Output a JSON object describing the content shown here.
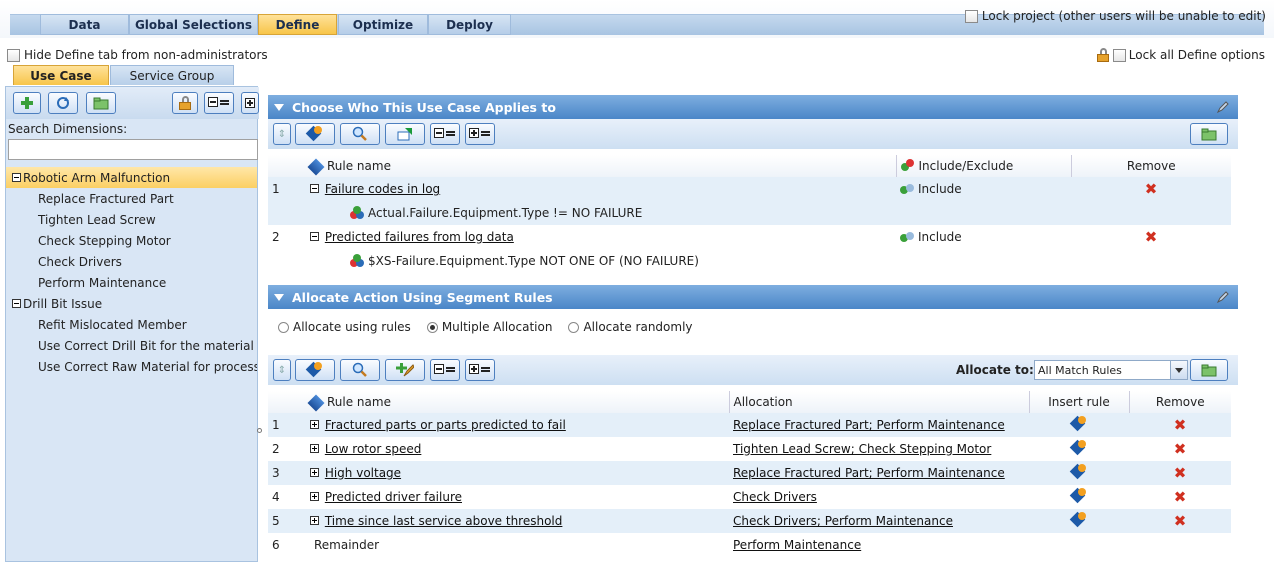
{
  "top_tabs": [
    {
      "label": "Data"
    },
    {
      "label": "Global Selections"
    },
    {
      "label": "Define"
    },
    {
      "label": "Optimize"
    },
    {
      "label": "Deploy"
    }
  ],
  "active_top_tab": "Define",
  "lock_project_label": "Lock project (other users will be unable to edit)",
  "hide_define_label": "Hide Define tab from non-administrators",
  "lock_all_label": "Lock all Define options",
  "sub_tabs": [
    {
      "label": "Use Case"
    },
    {
      "label": "Service Group"
    }
  ],
  "active_sub_tab": "Use Case",
  "left": {
    "search_label": "Search Dimensions:",
    "search_value": "",
    "tree": [
      {
        "label": "Robotic Arm Malfunction",
        "level": 0,
        "selected": true
      },
      {
        "label": "Replace Fractured Part",
        "level": 1
      },
      {
        "label": "Tighten Lead Screw",
        "level": 1
      },
      {
        "label": "Check Stepping Motor",
        "level": 1
      },
      {
        "label": "Check Drivers",
        "level": 1
      },
      {
        "label": "Perform Maintenance",
        "level": 1
      },
      {
        "label": "Drill Bit Issue",
        "level": 0
      },
      {
        "label": "Refit Mislocated Member",
        "level": 1
      },
      {
        "label": "Use Correct Drill Bit for the material",
        "level": 1
      },
      {
        "label": "Use Correct Raw Material for processi",
        "level": 1
      }
    ]
  },
  "who_panel": {
    "title": "Choose Who This Use Case Applies to",
    "headers": {
      "rule": "Rule name",
      "include": "Include/Exclude",
      "remove": "Remove"
    },
    "rows": [
      {
        "num": "1",
        "rule": "Failure codes in log",
        "condition": "Actual.Failure.Equipment.Type != NO FAILURE",
        "include": "Include"
      },
      {
        "num": "2",
        "rule": "Predicted failures from log data",
        "condition": "$XS-Failure.Equipment.Type NOT ONE OF (NO FAILURE)",
        "include": "Include"
      }
    ]
  },
  "alloc_panel": {
    "title": "Allocate Action Using Segment Rules",
    "radio_options": [
      {
        "label": "Allocate using rules",
        "checked": false
      },
      {
        "label": "Multiple Allocation",
        "checked": true
      },
      {
        "label": "Allocate randomly",
        "checked": false
      }
    ],
    "allocate_to_label": "Allocate to:",
    "allocate_to_value": "All Match Rules",
    "headers": {
      "rule": "Rule name",
      "allocation": "Allocation",
      "insert": "Insert rule",
      "remove": "Remove"
    },
    "rows": [
      {
        "num": "1",
        "rule": "Fractured parts or parts predicted to fail",
        "allocation": "Replace Fractured Part; Perform Maintenance"
      },
      {
        "num": "2",
        "rule": "Low rotor speed",
        "allocation": "Tighten Lead Screw; Check Stepping Motor"
      },
      {
        "num": "3",
        "rule": "High voltage",
        "allocation": "Replace Fractured Part; Perform Maintenance"
      },
      {
        "num": "4",
        "rule": "Predicted driver failure",
        "allocation": "Check Drivers"
      },
      {
        "num": "5",
        "rule": "Time since last service above threshold",
        "allocation": "Check Drivers; Perform Maintenance"
      },
      {
        "num": "6",
        "rule": "Remainder",
        "allocation": "Perform Maintenance"
      }
    ]
  },
  "colors": {
    "accent_gold": "#f7c54a",
    "header_blue": "#4a86c8",
    "remove_red": "#d03020"
  }
}
